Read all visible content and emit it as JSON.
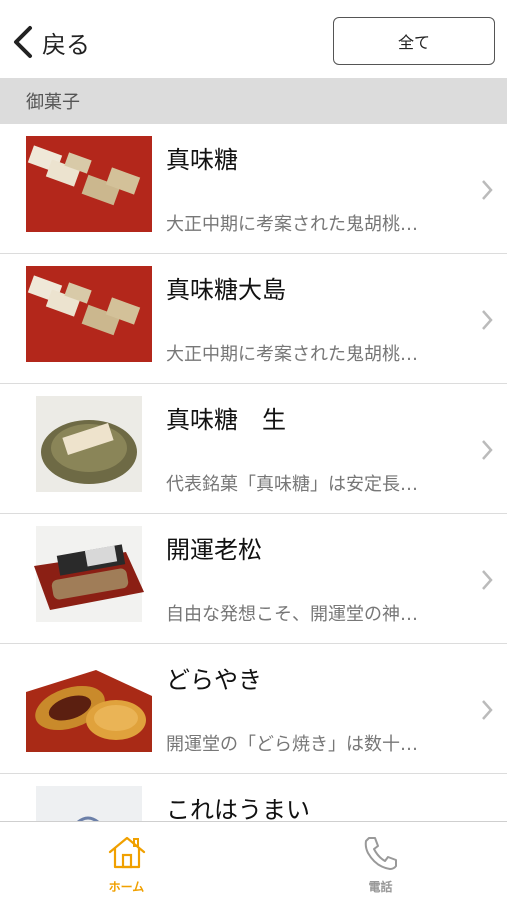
{
  "header": {
    "back_label": "戻る",
    "all_button": "全て"
  },
  "section": {
    "title": "御菓子"
  },
  "items": [
    {
      "title": "真味糖",
      "desc": "大正中期に考案された鬼胡桃…",
      "image": "shinmito-photo"
    },
    {
      "title": "真味糖大島",
      "desc": "大正中期に考案された鬼胡桃…",
      "image": "shinmito-oshima-photo"
    },
    {
      "title": "真味糖　生",
      "desc": "代表銘菓「真味糖」は安定長…",
      "image": "shinmito-nama-photo"
    },
    {
      "title": "開運老松",
      "desc": "自由な発想こそ、開運堂の神…",
      "image": "kaiun-oimatsu-photo"
    },
    {
      "title": "どらやき",
      "desc": "開運堂の「どら焼き」は数十…",
      "image": "dorayaki-photo"
    },
    {
      "title": "これはうまい",
      "desc": "",
      "image": "korehaumai-photo"
    }
  ],
  "tabs": [
    {
      "label": "ホーム",
      "icon": "home-icon",
      "active": true,
      "color": "#f0a000"
    },
    {
      "label": "電話",
      "icon": "phone-icon",
      "active": false,
      "color": "#999999"
    }
  ]
}
